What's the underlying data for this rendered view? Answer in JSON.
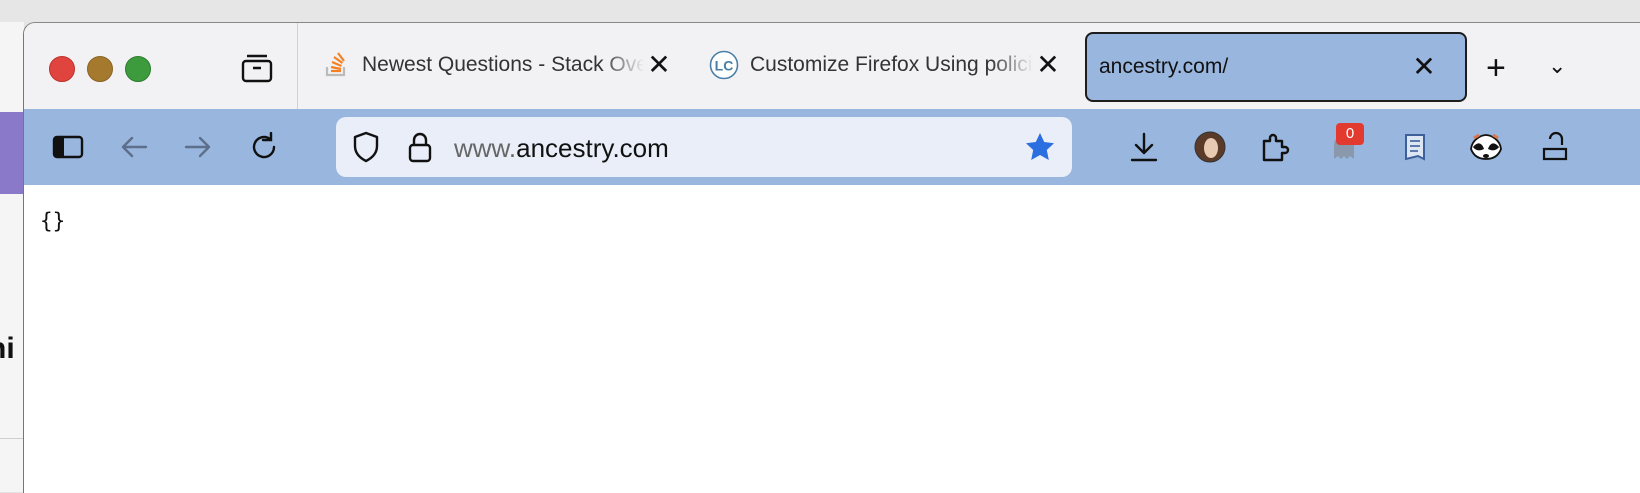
{
  "tabs": [
    {
      "title": "Newest Questions - Stack Overflow",
      "icon": "stackoverflow-icon",
      "close": "✕"
    },
    {
      "title": "Customize Firefox Using policies.json",
      "icon": "lc-icon",
      "icon_text": "LC",
      "close": "✕"
    },
    {
      "title": "ancestry.com/",
      "active": true,
      "close": "✕"
    }
  ],
  "new_tab_label": "+",
  "url": {
    "prefix": "www.",
    "domain": "ancestry.com"
  },
  "extension_badge": "0",
  "page": {
    "content": "{}"
  },
  "colors": {
    "toolbar": "#98b6de",
    "active_tab": "#98b6de",
    "bookmark_star": "#2a6ee0",
    "badge": "#e23a2f"
  }
}
